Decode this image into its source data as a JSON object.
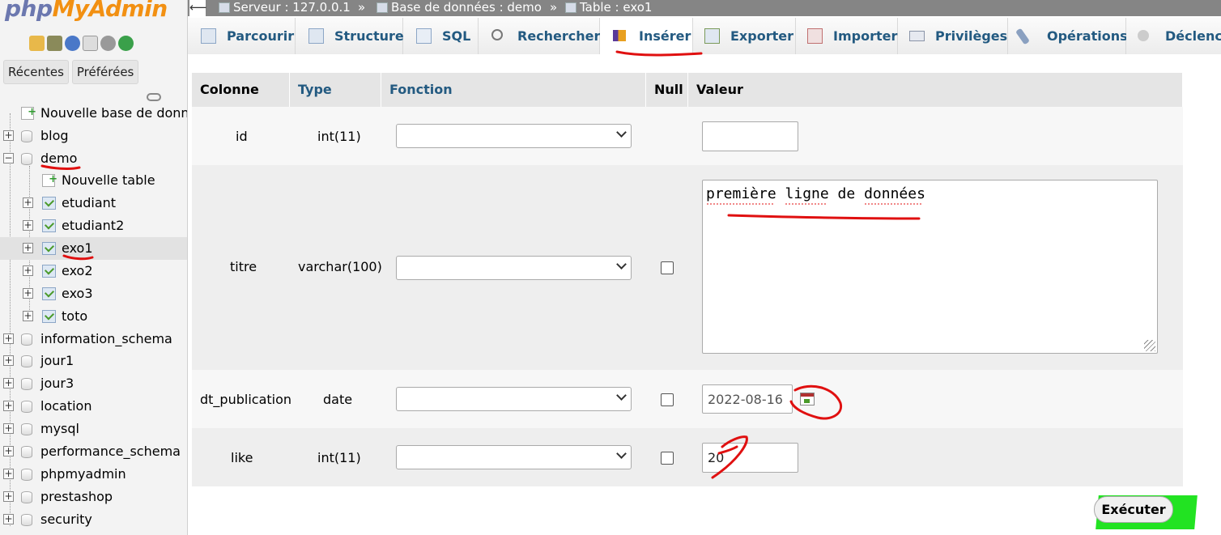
{
  "app": {
    "logo_part1": "php",
    "logo_part2": "MyAdmin",
    "recent_tab": "Récentes",
    "favorites_tab": "Préférées"
  },
  "tree": {
    "new_database": "Nouvelle base de données",
    "databases": [
      {
        "name": "blog"
      },
      {
        "name": "demo"
      },
      {
        "name": "information_schema"
      },
      {
        "name": "jour1"
      },
      {
        "name": "jour3"
      },
      {
        "name": "location"
      },
      {
        "name": "mysql"
      },
      {
        "name": "performance_schema"
      },
      {
        "name": "phpmyadmin"
      },
      {
        "name": "prestashop"
      },
      {
        "name": "security"
      }
    ],
    "demo_children": {
      "new_table": "Nouvelle table",
      "tables": [
        "etudiant",
        "etudiant2",
        "exo1",
        "exo2",
        "exo3",
        "toto"
      ]
    }
  },
  "breadcrumb": {
    "server": "Serveur : 127.0.0.1",
    "sep": "»",
    "database": "Base de données : demo",
    "table": "Table : exo1"
  },
  "tabs": [
    {
      "label": "Parcourir",
      "icon": "browse-icon"
    },
    {
      "label": "Structure",
      "icon": "structure-icon"
    },
    {
      "label": "SQL",
      "icon": "sql-icon"
    },
    {
      "label": "Rechercher",
      "icon": "search-icon"
    },
    {
      "label": "Insérer",
      "icon": "insert-icon",
      "active": true
    },
    {
      "label": "Exporter",
      "icon": "export-icon"
    },
    {
      "label": "Importer",
      "icon": "import-icon"
    },
    {
      "label": "Privilèges",
      "icon": "privileges-icon"
    },
    {
      "label": "Opérations",
      "icon": "operations-icon"
    },
    {
      "label": "Déclench",
      "icon": "triggers-icon"
    }
  ],
  "form": {
    "headers": {
      "column": "Colonne",
      "type": "Type",
      "function": "Fonction",
      "null": "Null",
      "value": "Valeur"
    },
    "rows": [
      {
        "column": "id",
        "type": "int(11)",
        "function": "",
        "value": ""
      },
      {
        "column": "titre",
        "type": "varchar(100)",
        "function": "",
        "value": "première ligne de données"
      },
      {
        "column": "dt_publication",
        "type": "date",
        "function": "",
        "value": "2022-08-16"
      },
      {
        "column": "like",
        "type": "int(11)",
        "function": "",
        "value": "20"
      }
    ],
    "submit": "Exécuter"
  },
  "colors": {
    "link": "#235a81",
    "annotation_red": "#e01010",
    "highlight_green": "#22e322"
  }
}
